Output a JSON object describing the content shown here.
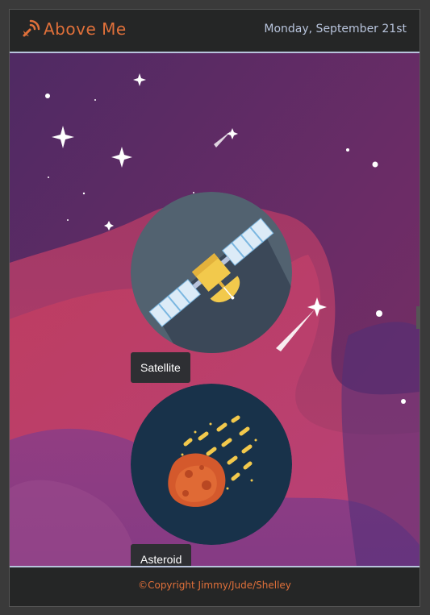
{
  "header": {
    "brand": "Above Me",
    "brand_icon": "satellite-dish-icon",
    "date": "Monday, September 21st"
  },
  "cards": [
    {
      "label": "Satellite",
      "icon": "satellite-icon"
    },
    {
      "label": "Asteroid",
      "icon": "asteroid-icon"
    }
  ],
  "footer": {
    "copyright": "©Copyright Jimmy/Jude/Shelley"
  },
  "colors": {
    "accent": "#e0703a",
    "header_bg": "#252626",
    "divider": "#b8c4dc",
    "sky_top": "#5b2a63",
    "sky_pink": "#c23d5f"
  }
}
